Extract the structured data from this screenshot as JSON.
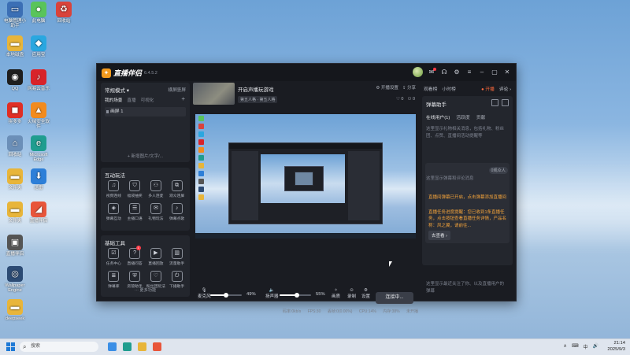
{
  "desktop": {
    "icons": [
      {
        "label": "电脑管理小助手",
        "color": "#3b6fb5",
        "icon": "monitor-icon"
      },
      {
        "label": "此电脑",
        "color": "#e8b53a",
        "icon": "computer-icon"
      },
      {
        "label": "回收站",
        "color": "#6b8fb8",
        "icon": "recycle-bin-icon"
      },
      {
        "label": "应用宝",
        "color": "#2aa7e0",
        "icon": "app-store-icon"
      },
      {
        "label": "QQ",
        "color": "#1e1e1e",
        "icon": "qq-icon"
      },
      {
        "label": "网易云音乐",
        "color": "#d8232a",
        "icon": "music-icon"
      },
      {
        "label": "拼多多",
        "color": "#e02e24",
        "icon": "shop-icon"
      },
      {
        "label": "火绒安全软件",
        "color": "#f28b1e",
        "icon": "fire-icon"
      },
      {
        "label": "Microsoft Edge",
        "color": "#1f9d8f",
        "icon": "edge-icon"
      },
      {
        "label": "本地磁盘",
        "color": "#e8b53a",
        "icon": "folder-icon"
      },
      {
        "label": "文件夹",
        "color": "#e8b53a",
        "icon": "folder-icon"
      },
      {
        "label": "迅雷",
        "color": "#2d7fd8",
        "icon": "download-icon"
      },
      {
        "label": "直播伴侣",
        "color": "#333",
        "icon": "app-icon"
      },
      {
        "label": "Wallpaper Engine",
        "color": "#2c4b74",
        "icon": "wallpaper-icon"
      },
      {
        "label": "deepseek",
        "color": "#e8b53a",
        "icon": "folder-icon"
      }
    ]
  },
  "app": {
    "name": "直播伴侣",
    "version": "6.4.5.2",
    "left": {
      "scene_mode": "常规模式 ▾",
      "scene_actions": [
        "横屏",
        "竖屏"
      ],
      "scene_tabs": [
        "我的场景",
        "直播",
        "可视化"
      ],
      "scene_item": "画屏 1",
      "add_scene": "+ 新增图片/文字/...",
      "interaction_title": "互动玩法",
      "interaction_tools": [
        {
          "label": "视频连线",
          "icon": "mic-icon"
        },
        {
          "label": "福袋抽奖",
          "icon": "gift-icon"
        },
        {
          "label": "多人连麦",
          "icon": "users-icon"
        },
        {
          "label": "观众连屏",
          "icon": "link-icon"
        },
        {
          "label": "弹幕互动",
          "icon": "game-icon"
        },
        {
          "label": "主播口语",
          "icon": "chat-icon"
        },
        {
          "label": "礼物玩法",
          "icon": "present-icon"
        },
        {
          "label": "弹幕点歌",
          "icon": "music-icon"
        }
      ],
      "basic_title": "基础工具",
      "basic_tools": [
        {
          "label": "任务中心",
          "icon": "task-icon"
        },
        {
          "label": "直播问答",
          "icon": "question-icon",
          "badge": "1"
        },
        {
          "label": "直播回放",
          "icon": "replay-icon"
        },
        {
          "label": "流量助手",
          "icon": "chart-icon"
        },
        {
          "label": "弹幕库",
          "icon": "list-icon"
        },
        {
          "label": "房管助手",
          "icon": "shield-icon"
        },
        {
          "label": "粉丝团玩法",
          "icon": "heart-icon"
        },
        {
          "label": "下播助手",
          "icon": "power-icon"
        }
      ],
      "more_tools": "··· 更多功能"
    },
    "live": {
      "title": "开启声播玩游戏",
      "tag": "第五人格 · 第五人格",
      "actions": [
        "开播设置",
        "分享"
      ],
      "stats": [
        "0",
        "0"
      ]
    },
    "controls": {
      "mic_label": "麦克风",
      "mic_pct": "49%",
      "mic_value": 0.49,
      "speaker_label": "扬声器",
      "speaker_pct": "55%",
      "speaker_value": 0.55,
      "tools": [
        "画质",
        "录制",
        "设置"
      ],
      "go_button": "连接中..."
    },
    "status": [
      "码率:0kb/s",
      "FPS:30",
      "丢帧:0(0.00%)",
      "CPU:14%",
      "内存:38%",
      "未开播"
    ],
    "right": {
      "tabs": [
        "观看榜",
        "小时榜",
        "TOP"
      ],
      "live_label": "● 开播",
      "more_label": "评论 ›",
      "danmu_title": "弹幕助手",
      "subtabs": [
        "在线用户(1)",
        "活跃度",
        "贡献"
      ],
      "tip1": "这里显示礼物相关消息，包括礼物、粉丝团、点赞、直播间活动提醒等",
      "online": "0观众人",
      "tip2": "这里显示弹幕和评论消息",
      "warn1": "直播间弹幕已开启，点击弹幕添加直播间",
      "warn2": "直播任务进度提醒：您已收到1条直播任务，点击按钮查看直播任务详情，产品名称：风之翼，请前往...",
      "detail_button": "去查看 ›",
      "bottom_tip": "这里显示最近关注了你、以及直播用户的弹幕"
    }
  },
  "taskbar": {
    "search": "搜索",
    "tray": [
      "∧",
      "⌨",
      "中",
      "🔊"
    ],
    "time": "21:14",
    "date": "2025/9/3"
  }
}
